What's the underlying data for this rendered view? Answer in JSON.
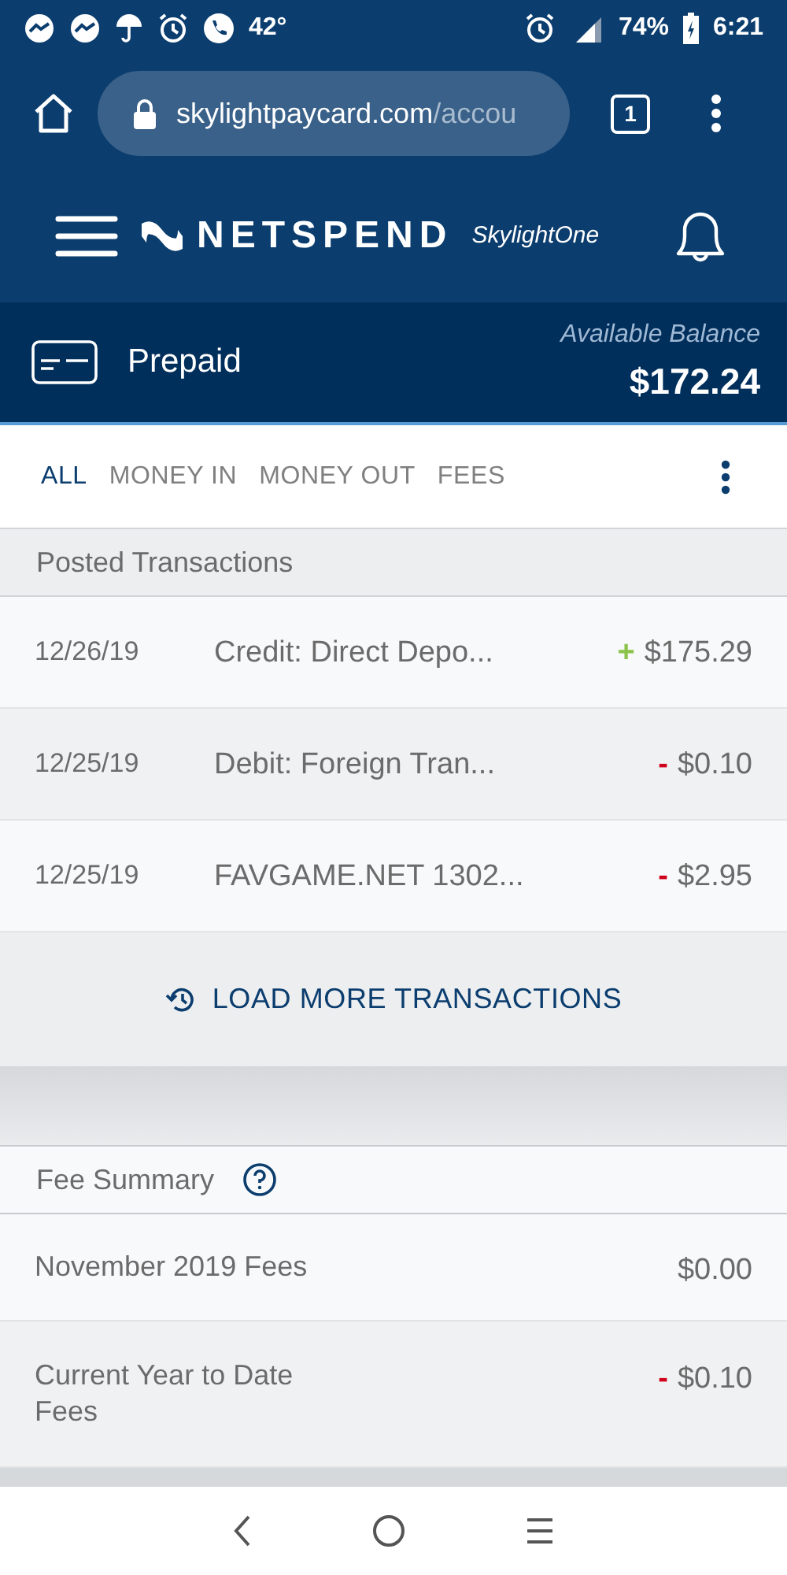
{
  "status_bar": {
    "temperature": "42°",
    "battery": "74%",
    "time": "6:21"
  },
  "browser": {
    "url_host": "skylightpaycard.com",
    "url_path": "/accou",
    "tab_count": "1"
  },
  "header": {
    "brand": "NETSPEND",
    "product": "SkylightOne"
  },
  "account": {
    "name": "Prepaid",
    "balance_label": "Available Balance",
    "balance": "$172.24"
  },
  "tabs": [
    {
      "label": "ALL",
      "selected": true
    },
    {
      "label": "MONEY IN",
      "selected": false
    },
    {
      "label": "MONEY OUT",
      "selected": false
    },
    {
      "label": "FEES",
      "selected": false
    }
  ],
  "posted": {
    "title": "Posted Transactions",
    "rows": [
      {
        "date": "12/26/19",
        "description": "Credit: Direct Depo...",
        "kind": "credit",
        "sign": "+",
        "amount": "$175.29"
      },
      {
        "date": "12/25/19",
        "description": "Debit: Foreign Tran...",
        "kind": "debit",
        "sign": "-",
        "amount": "$0.10"
      },
      {
        "date": "12/25/19",
        "description": "FAVGAME.NET 1302...",
        "kind": "debit",
        "sign": "-",
        "amount": "$2.95"
      }
    ],
    "load_more": "LOAD MORE TRANSACTIONS"
  },
  "fees": {
    "title": "Fee Summary",
    "rows": [
      {
        "label": "November 2019 Fees",
        "amount": "$0.00"
      },
      {
        "label": "Current Year to Date Fees",
        "kind": "debit",
        "sign": "-",
        "amount": "$0.10"
      }
    ]
  }
}
